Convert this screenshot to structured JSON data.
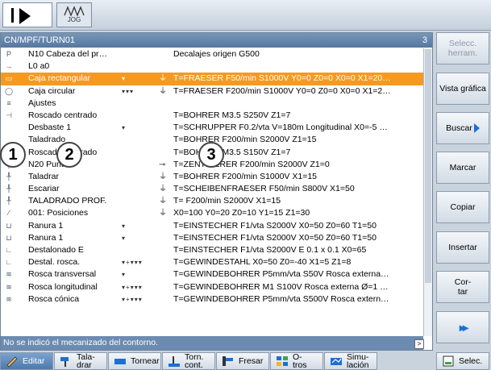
{
  "topbar": {
    "jog_label": "JOG"
  },
  "panel": {
    "title": "CN/MPF/TURN01",
    "count": "3",
    "status": "No se indicó el mecanizado del contorno.",
    "status_arrow": ">"
  },
  "rows": [
    {
      "icon": "P",
      "name": "N10 Cabeza del pr…",
      "mark": "",
      "mk2": "",
      "detail": "Decalajes origen G500"
    },
    {
      "icon": "→",
      "name": "L0 a0",
      "mark": "",
      "mk2": "",
      "detail": ""
    },
    {
      "icon": "▭",
      "name": "Caja rectangular",
      "mark": "▾",
      "mk2": "⏚",
      "detail": "T=FRAESER F50/min S1000V Y0=0 Z0=0 X0=0 X1=20…"
    },
    {
      "icon": "◯",
      "name": "Caja circular",
      "mark": "▾▾▾",
      "mk2": "⏚",
      "detail": "T=FRAESER F200/min S1000V Y0=0 Z0=0 X0=0 X1=2…"
    },
    {
      "icon": "≡",
      "name": "Ajustes",
      "mark": "",
      "mk2": "",
      "detail": ""
    },
    {
      "icon": "⊣",
      "name": "Roscado centrado",
      "mark": "",
      "mk2": "",
      "detail": "T=BOHRER M3.5 S250V Z1=7"
    },
    {
      "icon": "",
      "name": "Desbaste 1",
      "mark": "▾",
      "mk2": "",
      "detail": "T=SCHRUPPER F0.2/vta V=180m Longitudinal X0=-5 …"
    },
    {
      "icon": "",
      "name": "Taladrado",
      "mark": "",
      "mk2": "",
      "detail": "T=BOHRER F200/min S2000V Z1=15"
    },
    {
      "icon": "",
      "name": "Roscado centrado",
      "mark": "",
      "mk2": "",
      "detail": "T=BOHRER M3.5 S150V Z1=7"
    },
    {
      "icon": "╀",
      "name": "N20 Puntear",
      "mark": "",
      "mk2": "⊸",
      "detail": "T=ZENTRIERER F200/min S2000V Z1=0"
    },
    {
      "icon": "╀",
      "name": "Taladrar",
      "mark": "",
      "mk2": "⏚",
      "detail": "T=BOHRER F200/min S1000V X1=15"
    },
    {
      "icon": "╀",
      "name": "Escariar",
      "mark": "",
      "mk2": "⏚",
      "detail": "T=SCHEIBENFRAESER F50/min S800V X1=50"
    },
    {
      "icon": "╀",
      "name": "TALADRADO PROF.",
      "mark": "",
      "mk2": "⏚",
      "detail": "T= F200/min S2000V X1=15"
    },
    {
      "icon": "⁄",
      "name": "001: Posiciones",
      "mark": "",
      "mk2": "⏚",
      "detail": "X0=100 Y0=20 Z0=10 Y1=15 Z1=30"
    },
    {
      "icon": "⊔",
      "name": "Ranura 1",
      "mark": "▾",
      "mk2": "",
      "detail": "T=EINSTECHER F1/vta S2000V X0=50 Z0=60 T1=50"
    },
    {
      "icon": "⊔",
      "name": "Ranura 1",
      "mark": "▾",
      "mk2": "",
      "detail": "T=EINSTECHER F1/vta S2000V X0=50 Z0=60 T1=50"
    },
    {
      "icon": "∟",
      "name": "Destalonado E",
      "mark": "",
      "mk2": "",
      "detail": "T=EINSTECHER F1/vta S2000V E 0.1 x 0.1 X0=65"
    },
    {
      "icon": "∟",
      "name": "Destal. rosca.",
      "mark": "▾+▾▾▾",
      "mk2": "",
      "detail": "T=GEWINDESTAHL X0=50 Z0=-40 X1=5 Z1=8"
    },
    {
      "icon": "≋",
      "name": "Rosca transversal",
      "mark": "▾",
      "mk2": "",
      "detail": "T=GEWINDEBOHRER P5mm/vta S50V Rosca externa…"
    },
    {
      "icon": "≋",
      "name": "Rosca longitudinal",
      "mark": "▾+▾▾▾",
      "mk2": "",
      "detail": "T=GEWINDEBOHRER M1 S100V Rosca externa Ø=1 …"
    },
    {
      "icon": "≋",
      "name": "Rosca cónica",
      "mark": "▾+▾▾▾",
      "mk2": "",
      "detail": "T=GEWINDEBOHRER P5mm/vta S500V Rosca extern…"
    }
  ],
  "callouts": [
    "1",
    "2",
    "3"
  ],
  "right_softkeys": {
    "select_tool": "Selecc. herram.",
    "graphic_view": "Vista gráfica",
    "search": "Buscar",
    "mark": "Marcar",
    "copy": "Copiar",
    "insert": "Insertar",
    "cut": "Cor- tar",
    "more": "▸▸"
  },
  "bottom_softkeys": {
    "edit": "Editar",
    "drill": "Tala- drar",
    "turn": "Tornear",
    "contour_turn": "Torn. cont.",
    "mill": "Fresar",
    "others": "O- tros",
    "simulation": "Simu- lación",
    "select": "Selec."
  },
  "colors": {
    "selection": "#f59a1f",
    "header": "#5677a0",
    "accent": "#1d6fd4"
  }
}
